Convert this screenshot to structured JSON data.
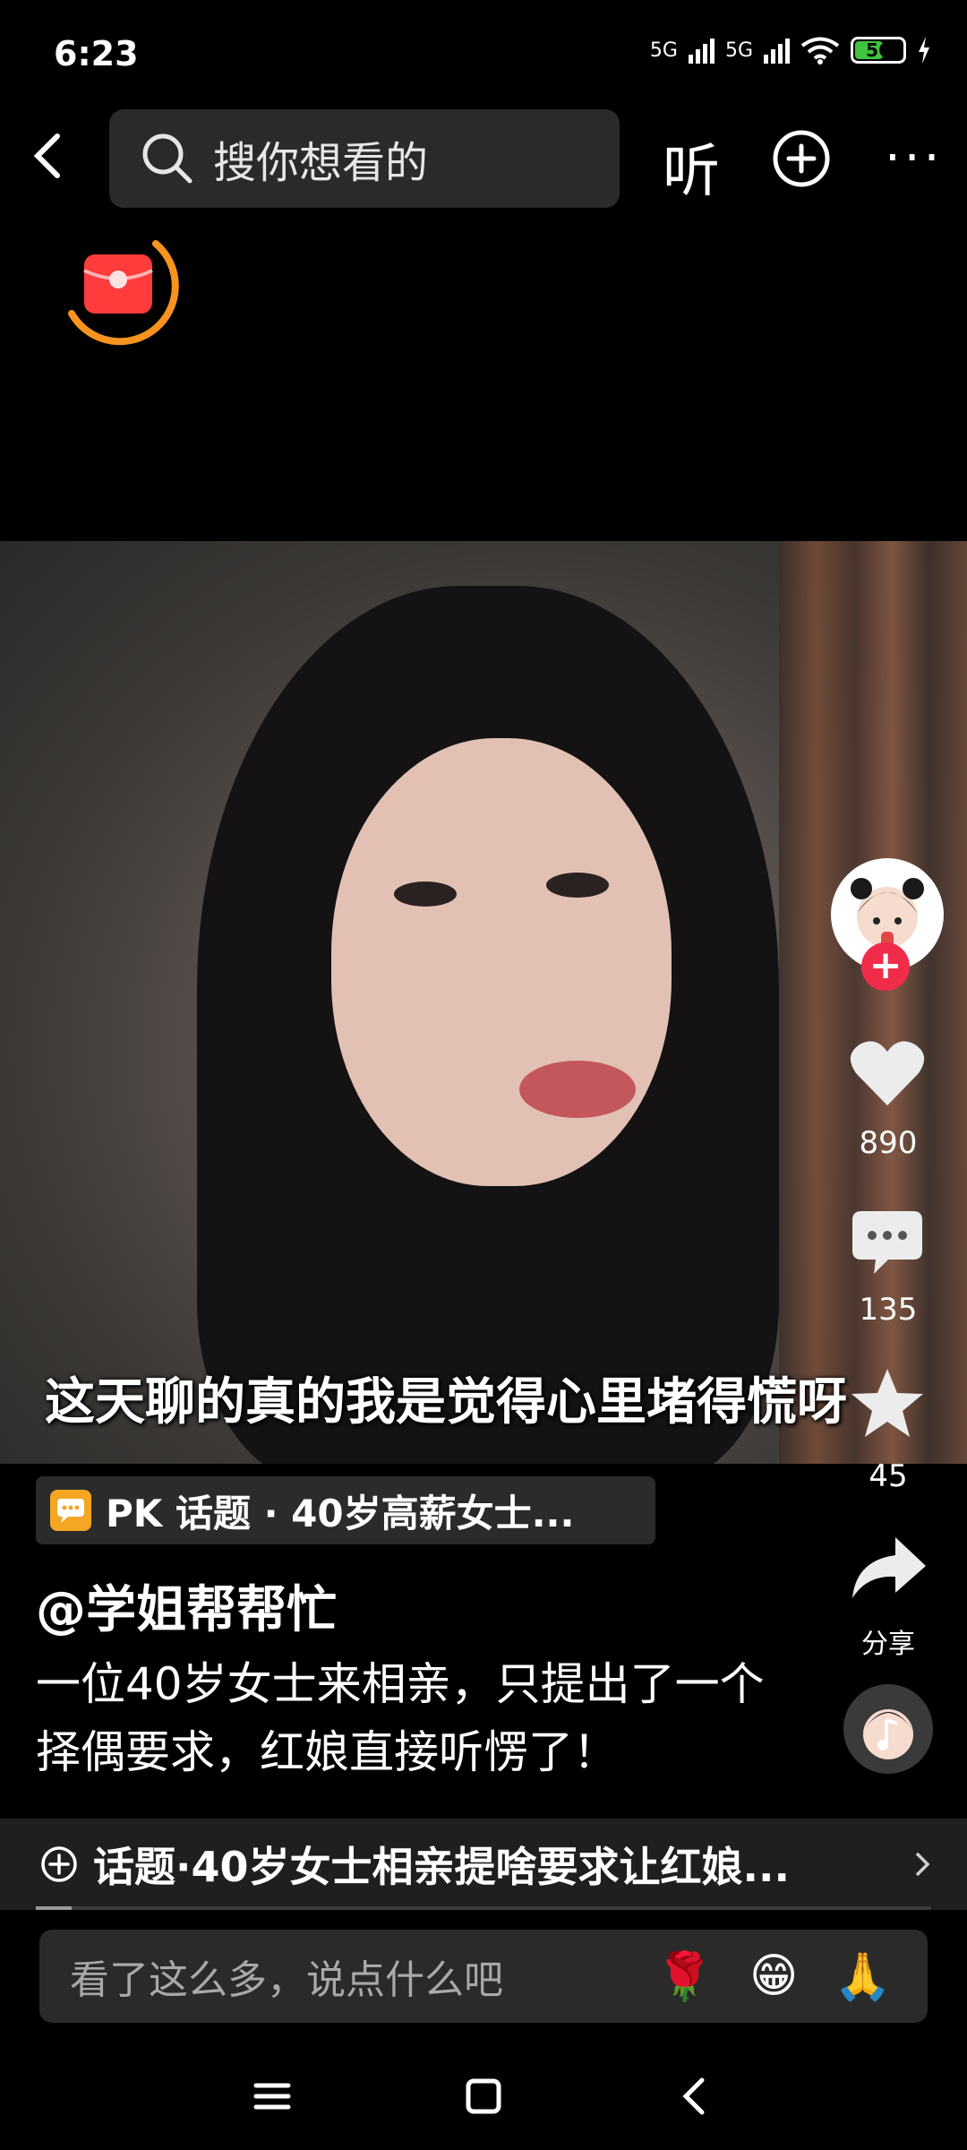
{
  "status_bar": {
    "time": "6:23",
    "network_1": "5G",
    "network_2": "5G",
    "battery_level": "56",
    "battery_fraction": 0.56
  },
  "top_bar": {
    "search_placeholder": "搜你想看的",
    "listen_label": "听",
    "more_label": "···"
  },
  "video": {
    "subtitle": "这天聊的真的我是觉得心里堵得慌呀"
  },
  "side_actions": {
    "likes": "890",
    "comments": "135",
    "favorites": "45",
    "share_label": "分享"
  },
  "pk_topic": {
    "label": "PK 话题 · 40岁高薪女士..."
  },
  "post": {
    "author": "@学姐帮帮忙",
    "description": "一位40岁女士来相亲，只提出了一个择偶要求，红娘直接听愣了！"
  },
  "topic_bar": {
    "label": "话题·40岁女士相亲提啥要求让红娘..."
  },
  "playback_progress": 0.04,
  "comment_bar": {
    "placeholder": "看了这么多，说点什么吧",
    "emojis": [
      "🌹",
      "😁",
      "🙏"
    ]
  },
  "colors": {
    "accent_red": "#f02c4b",
    "redpacket_ring": "#f7931e",
    "pk_badge": "#f5a623"
  }
}
